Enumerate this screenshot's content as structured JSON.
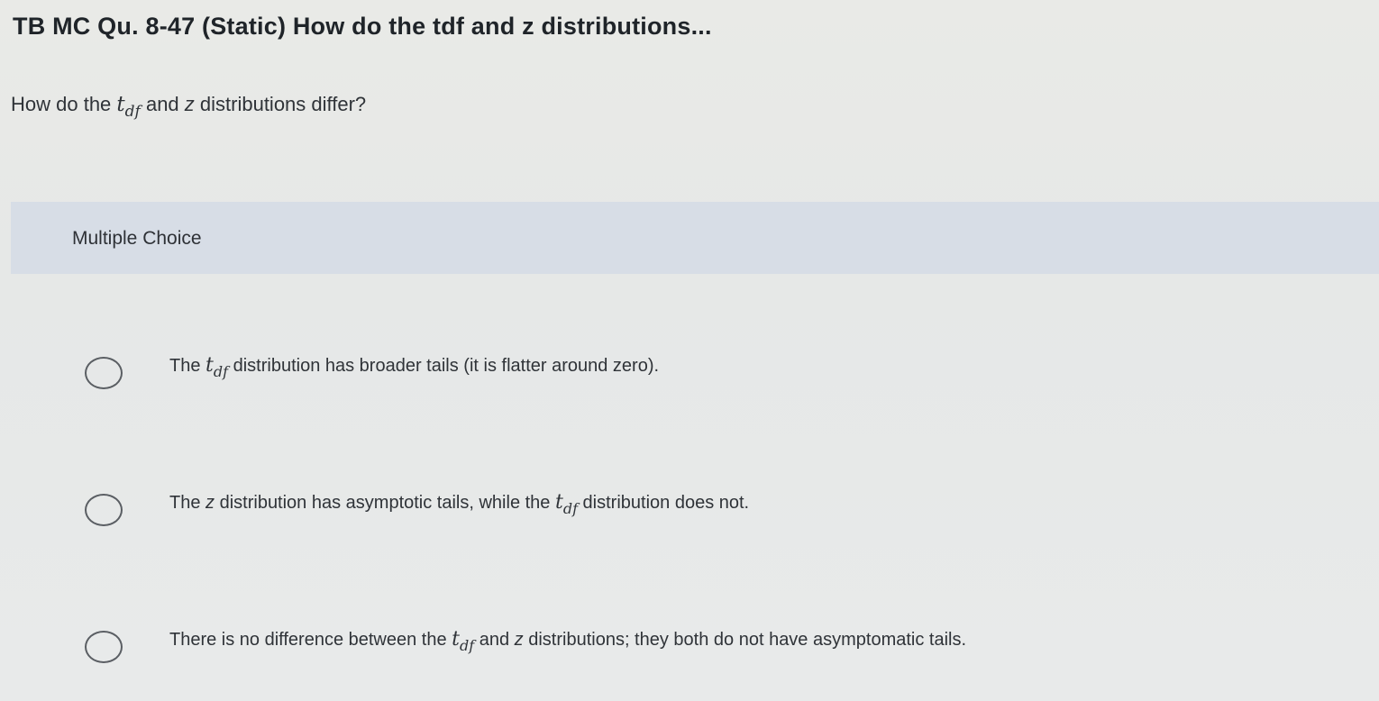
{
  "header": {
    "title": "TB MC Qu. 8-47 (Static) How do the tdf and z distributions..."
  },
  "question": {
    "prefix": "How do the ",
    "t_var": "t",
    "t_sub": "df",
    "middle": " and ",
    "z_var": "z",
    "suffix": " distributions differ?"
  },
  "multiple_choice": {
    "label": "Multiple Choice",
    "options": [
      {
        "part1": "The ",
        "t_var": "t",
        "t_sub": "df",
        "part2": " distribution has broader tails (it is flatter around zero)."
      },
      {
        "part1": "The ",
        "z_var": "z",
        "part2": " distribution has asymptotic tails, while the ",
        "t_var": "t",
        "t_sub": "df",
        "part3": " distribution does not."
      },
      {
        "part1": "There is no difference between the ",
        "t_var": "t",
        "t_sub": "df",
        "part2": " and ",
        "z_var": "z",
        "part3": " distributions; they both do not have asymptomatic tails."
      }
    ]
  }
}
